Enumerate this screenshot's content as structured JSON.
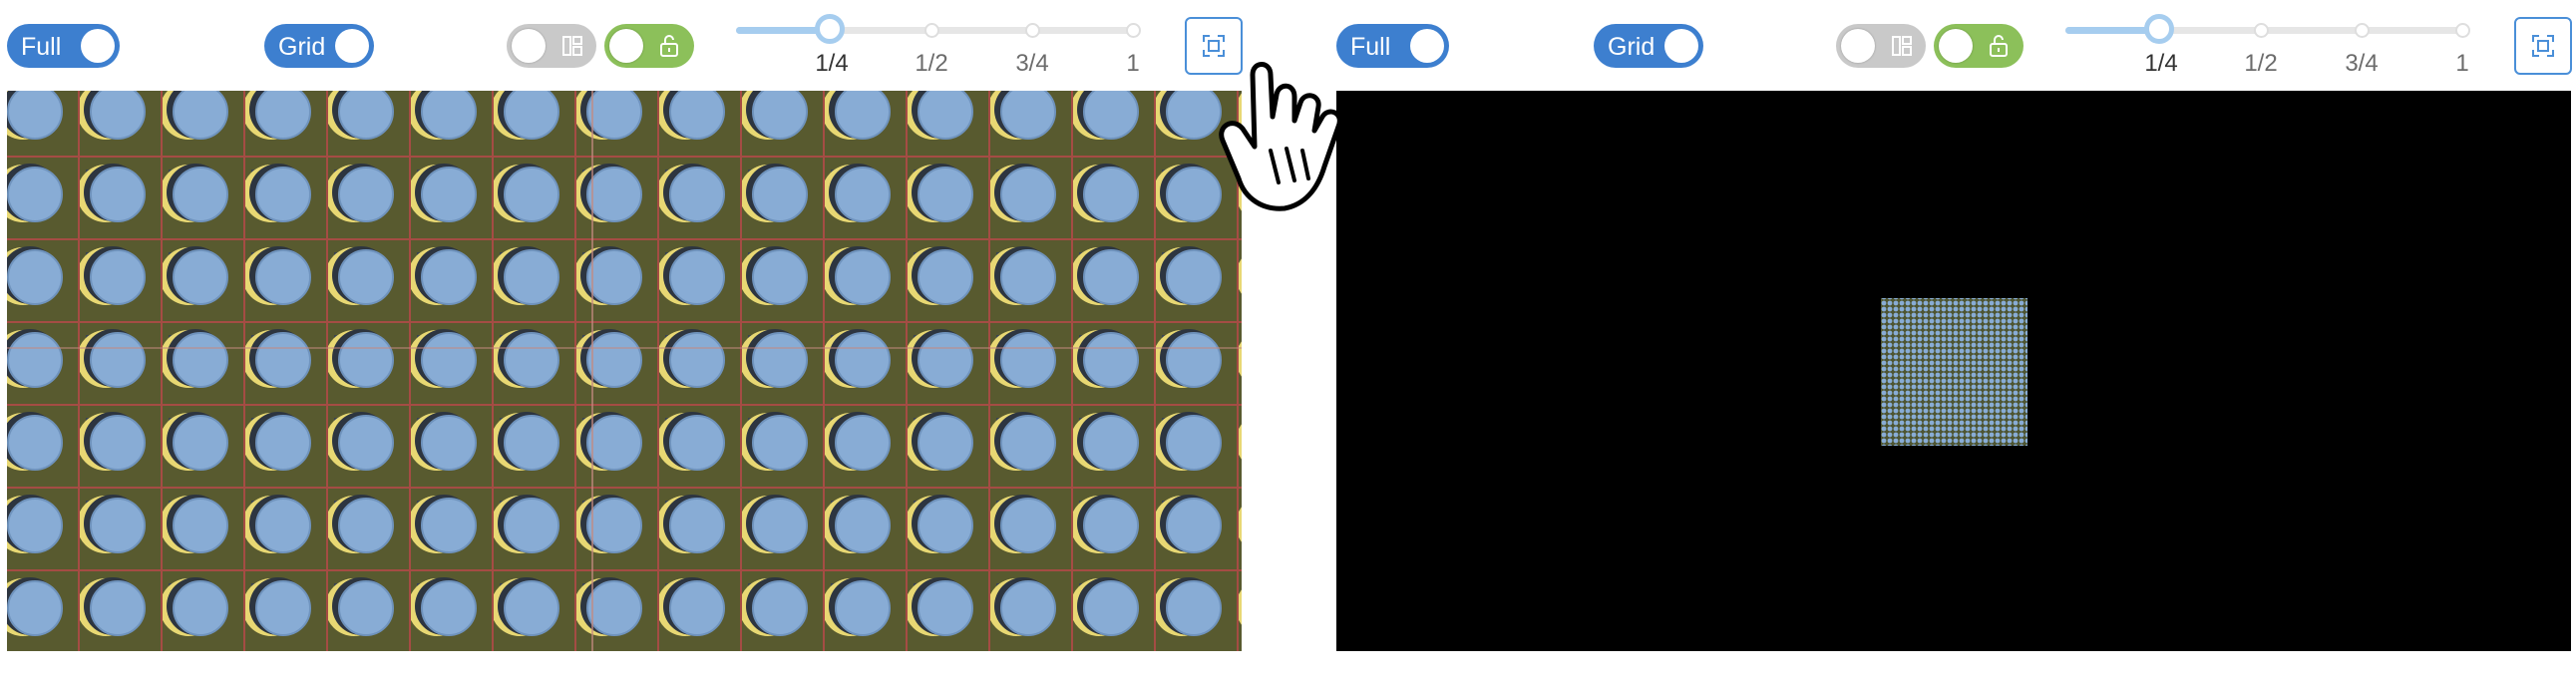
{
  "panels": [
    {
      "toolbar": {
        "full_label": "Full",
        "grid_label": "Grid",
        "layout_switch_icon": "grid-layout-icon",
        "lock_switch_icon": "unlock-icon",
        "scale_ticks": [
          "1/4",
          "1/2",
          "3/4",
          "1"
        ],
        "scale_selected": "1/4",
        "fit_icon": "fit-screen-icon"
      },
      "viewport": {
        "content": "tiled-pattern",
        "zoom": "full-view"
      }
    },
    {
      "toolbar": {
        "full_label": "Full",
        "grid_label": "Grid",
        "layout_switch_icon": "grid-layout-icon",
        "lock_switch_icon": "unlock-icon",
        "scale_ticks": [
          "1/4",
          "1/2",
          "3/4",
          "1"
        ],
        "scale_selected": "1/4",
        "fit_icon": "fit-screen-icon"
      },
      "viewport": {
        "content": "tiled-pattern",
        "zoom": "zoomed-out",
        "background": "#000000"
      }
    }
  ],
  "cursor": "hand-pointer-icon",
  "colors": {
    "accent": "#3d7fcf",
    "toggle_off": "#c9c9c9",
    "lock_on": "#8cc05a",
    "slider_fill": "#a6cdef",
    "pattern_bg": "#585a2f",
    "pattern_dark": "#3a4450",
    "pattern_circle": "#88acd5",
    "pattern_crescent": "#e8d873",
    "pattern_grid": "#a54c44"
  }
}
